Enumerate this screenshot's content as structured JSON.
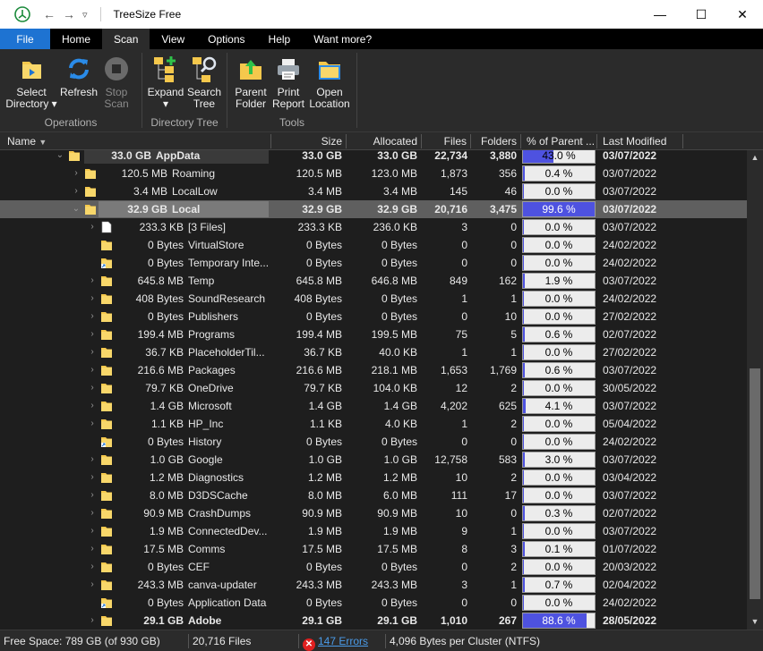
{
  "window": {
    "title": "TreeSize Free",
    "minimize": "—",
    "maximize": "☐",
    "close": "✕"
  },
  "nav": {
    "back": "←",
    "forward": "→",
    "dropdown": "▿"
  },
  "tabs": [
    "File",
    "Home",
    "Scan",
    "View",
    "Options",
    "Help",
    "Want more?"
  ],
  "active_tab": "Scan",
  "ribbon": {
    "groups": [
      {
        "label": "Operations",
        "buttons": [
          {
            "label1": "Select",
            "label2": "Directory ▾",
            "icon": "folder-arrow-icon"
          },
          {
            "label1": "Refresh",
            "label2": "",
            "icon": "refresh-icon"
          },
          {
            "label1": "Stop",
            "label2": "Scan",
            "icon": "stop-icon",
            "disabled": true
          }
        ]
      },
      {
        "label": "Directory Tree",
        "buttons": [
          {
            "label1": "Expand",
            "label2": "▾",
            "icon": "expand-tree-icon"
          },
          {
            "label1": "Search",
            "label2": "Tree",
            "icon": "search-tree-icon"
          }
        ]
      },
      {
        "label": "Tools",
        "buttons": [
          {
            "label1": "Parent",
            "label2": "Folder",
            "icon": "parent-folder-icon"
          },
          {
            "label1": "Print",
            "label2": "Report",
            "icon": "printer-icon"
          },
          {
            "label1": "Open",
            "label2": "Location",
            "icon": "open-location-icon"
          }
        ]
      }
    ]
  },
  "columns": {
    "name": "Name",
    "size": "Size",
    "allocated": "Allocated",
    "files": "Files",
    "folders": "Folders",
    "percent": "% of Parent ...",
    "modified": "Last Modified"
  },
  "rows": [
    {
      "depth": 0,
      "expander": "open",
      "icon": "folder",
      "nsize": "33.0 GB",
      "name": "AppData",
      "size": "33.0 GB",
      "alloc": "33.0 GB",
      "files": "22,734",
      "folders": "3,880",
      "pct": 43.0,
      "pct_text": "43.0 %",
      "mod": "03/07/2022",
      "bold": true
    },
    {
      "depth": 1,
      "expander": "closed",
      "icon": "folder",
      "nsize": "120.5 MB",
      "name": "Roaming",
      "size": "120.5 MB",
      "alloc": "123.0 MB",
      "files": "1,873",
      "folders": "356",
      "pct": 0.4,
      "pct_text": "0.4 %",
      "mod": "03/07/2022"
    },
    {
      "depth": 1,
      "expander": "closed",
      "icon": "folder",
      "nsize": "3.4 MB",
      "name": "LocalLow",
      "size": "3.4 MB",
      "alloc": "3.4 MB",
      "files": "145",
      "folders": "46",
      "pct": 0.0,
      "pct_text": "0.0 %",
      "mod": "03/07/2022"
    },
    {
      "depth": 1,
      "expander": "open",
      "icon": "folder",
      "nsize": "32.9 GB",
      "name": "Local",
      "size": "32.9 GB",
      "alloc": "32.9 GB",
      "files": "20,716",
      "folders": "3,475",
      "pct": 99.6,
      "pct_text": "99.6 %",
      "mod": "03/07/2022",
      "bold": true,
      "selected": true
    },
    {
      "depth": 2,
      "expander": "closed",
      "icon": "file",
      "nsize": "233.3 KB",
      "name": "[3 Files]",
      "size": "233.3 KB",
      "alloc": "236.0 KB",
      "files": "3",
      "folders": "0",
      "pct": 0.0,
      "pct_text": "0.0 %",
      "mod": "03/07/2022"
    },
    {
      "depth": 2,
      "expander": "none",
      "icon": "folder",
      "nsize": "0 Bytes",
      "name": "VirtualStore",
      "size": "0 Bytes",
      "alloc": "0 Bytes",
      "files": "0",
      "folders": "0",
      "pct": 0.0,
      "pct_text": "0.0 %",
      "mod": "24/02/2022"
    },
    {
      "depth": 2,
      "expander": "none",
      "icon": "shortcut",
      "nsize": "0 Bytes",
      "name": "Temporary Inte...",
      "size": "0 Bytes",
      "alloc": "0 Bytes",
      "files": "0",
      "folders": "0",
      "pct": 0.0,
      "pct_text": "0.0 %",
      "mod": "24/02/2022"
    },
    {
      "depth": 2,
      "expander": "closed",
      "icon": "folder",
      "nsize": "645.8 MB",
      "name": "Temp",
      "size": "645.8 MB",
      "alloc": "646.8 MB",
      "files": "849",
      "folders": "162",
      "pct": 1.9,
      "pct_text": "1.9 %",
      "mod": "03/07/2022"
    },
    {
      "depth": 2,
      "expander": "closed",
      "icon": "folder",
      "nsize": "408 Bytes",
      "name": "SoundResearch",
      "size": "408 Bytes",
      "alloc": "0 Bytes",
      "files": "1",
      "folders": "1",
      "pct": 0.0,
      "pct_text": "0.0 %",
      "mod": "24/02/2022"
    },
    {
      "depth": 2,
      "expander": "closed",
      "icon": "folder",
      "nsize": "0 Bytes",
      "name": "Publishers",
      "size": "0 Bytes",
      "alloc": "0 Bytes",
      "files": "0",
      "folders": "10",
      "pct": 0.0,
      "pct_text": "0.0 %",
      "mod": "27/02/2022"
    },
    {
      "depth": 2,
      "expander": "closed",
      "icon": "folder",
      "nsize": "199.4 MB",
      "name": "Programs",
      "size": "199.4 MB",
      "alloc": "199.5 MB",
      "files": "75",
      "folders": "5",
      "pct": 0.6,
      "pct_text": "0.6 %",
      "mod": "02/07/2022"
    },
    {
      "depth": 2,
      "expander": "closed",
      "icon": "folder",
      "nsize": "36.7 KB",
      "name": "PlaceholderTil...",
      "size": "36.7 KB",
      "alloc": "40.0 KB",
      "files": "1",
      "folders": "1",
      "pct": 0.0,
      "pct_text": "0.0 %",
      "mod": "27/02/2022"
    },
    {
      "depth": 2,
      "expander": "closed",
      "icon": "folder",
      "nsize": "216.6 MB",
      "name": "Packages",
      "size": "216.6 MB",
      "alloc": "218.1 MB",
      "files": "1,653",
      "folders": "1,769",
      "pct": 0.6,
      "pct_text": "0.6 %",
      "mod": "03/07/2022"
    },
    {
      "depth": 2,
      "expander": "closed",
      "icon": "folder",
      "nsize": "79.7 KB",
      "name": "OneDrive",
      "size": "79.7 KB",
      "alloc": "104.0 KB",
      "files": "12",
      "folders": "2",
      "pct": 0.0,
      "pct_text": "0.0 %",
      "mod": "30/05/2022"
    },
    {
      "depth": 2,
      "expander": "closed",
      "icon": "folder",
      "nsize": "1.4 GB",
      "name": "Microsoft",
      "size": "1.4 GB",
      "alloc": "1.4 GB",
      "files": "4,202",
      "folders": "625",
      "pct": 4.1,
      "pct_text": "4.1 %",
      "mod": "03/07/2022"
    },
    {
      "depth": 2,
      "expander": "closed",
      "icon": "folder",
      "nsize": "1.1 KB",
      "name": "HP_Inc",
      "size": "1.1 KB",
      "alloc": "4.0 KB",
      "files": "1",
      "folders": "2",
      "pct": 0.0,
      "pct_text": "0.0 %",
      "mod": "05/04/2022"
    },
    {
      "depth": 2,
      "expander": "none",
      "icon": "shortcut",
      "nsize": "0 Bytes",
      "name": "History",
      "size": "0 Bytes",
      "alloc": "0 Bytes",
      "files": "0",
      "folders": "0",
      "pct": 0.0,
      "pct_text": "0.0 %",
      "mod": "24/02/2022"
    },
    {
      "depth": 2,
      "expander": "closed",
      "icon": "folder",
      "nsize": "1.0 GB",
      "name": "Google",
      "size": "1.0 GB",
      "alloc": "1.0 GB",
      "files": "12,758",
      "folders": "583",
      "pct": 3.0,
      "pct_text": "3.0 %",
      "mod": "03/07/2022"
    },
    {
      "depth": 2,
      "expander": "closed",
      "icon": "folder",
      "nsize": "1.2 MB",
      "name": "Diagnostics",
      "size": "1.2 MB",
      "alloc": "1.2 MB",
      "files": "10",
      "folders": "2",
      "pct": 0.0,
      "pct_text": "0.0 %",
      "mod": "03/04/2022"
    },
    {
      "depth": 2,
      "expander": "closed",
      "icon": "folder",
      "nsize": "8.0 MB",
      "name": "D3DSCache",
      "size": "8.0 MB",
      "alloc": "6.0 MB",
      "files": "111",
      "folders": "17",
      "pct": 0.0,
      "pct_text": "0.0 %",
      "mod": "03/07/2022"
    },
    {
      "depth": 2,
      "expander": "closed",
      "icon": "folder",
      "nsize": "90.9 MB",
      "name": "CrashDumps",
      "size": "90.9 MB",
      "alloc": "90.9 MB",
      "files": "10",
      "folders": "0",
      "pct": 0.3,
      "pct_text": "0.3 %",
      "mod": "02/07/2022"
    },
    {
      "depth": 2,
      "expander": "closed",
      "icon": "folder",
      "nsize": "1.9 MB",
      "name": "ConnectedDev...",
      "size": "1.9 MB",
      "alloc": "1.9 MB",
      "files": "9",
      "folders": "1",
      "pct": 0.0,
      "pct_text": "0.0 %",
      "mod": "03/07/2022"
    },
    {
      "depth": 2,
      "expander": "closed",
      "icon": "folder",
      "nsize": "17.5 MB",
      "name": "Comms",
      "size": "17.5 MB",
      "alloc": "17.5 MB",
      "files": "8",
      "folders": "3",
      "pct": 0.1,
      "pct_text": "0.1 %",
      "mod": "01/07/2022"
    },
    {
      "depth": 2,
      "expander": "closed",
      "icon": "folder",
      "nsize": "0 Bytes",
      "name": "CEF",
      "size": "0 Bytes",
      "alloc": "0 Bytes",
      "files": "0",
      "folders": "2",
      "pct": 0.0,
      "pct_text": "0.0 %",
      "mod": "20/03/2022"
    },
    {
      "depth": 2,
      "expander": "closed",
      "icon": "folder",
      "nsize": "243.3 MB",
      "name": "canva-updater",
      "size": "243.3 MB",
      "alloc": "243.3 MB",
      "files": "3",
      "folders": "1",
      "pct": 0.7,
      "pct_text": "0.7 %",
      "mod": "02/04/2022"
    },
    {
      "depth": 2,
      "expander": "none",
      "icon": "shortcut",
      "nsize": "0 Bytes",
      "name": "Application Data",
      "size": "0 Bytes",
      "alloc": "0 Bytes",
      "files": "0",
      "folders": "0",
      "pct": 0.0,
      "pct_text": "0.0 %",
      "mod": "24/02/2022"
    },
    {
      "depth": 2,
      "expander": "closed",
      "icon": "folder",
      "nsize": "29.1 GB",
      "name": "Adobe",
      "size": "29.1 GB",
      "alloc": "29.1 GB",
      "files": "1,010",
      "folders": "267",
      "pct": 88.6,
      "pct_text": "88.6 %",
      "mod": "28/05/2022",
      "bold": true
    }
  ],
  "status": {
    "free_space": "Free Space: 789 GB  (of 930 GB)",
    "files": "20,716 Files",
    "errors": "147 Errors",
    "cluster": "4,096 Bytes per Cluster (NTFS)"
  },
  "colors": {
    "accent": "#1e73d2",
    "percent_bar": "#4e52e0",
    "folder": "#f5c84c",
    "error": "#e02020"
  }
}
